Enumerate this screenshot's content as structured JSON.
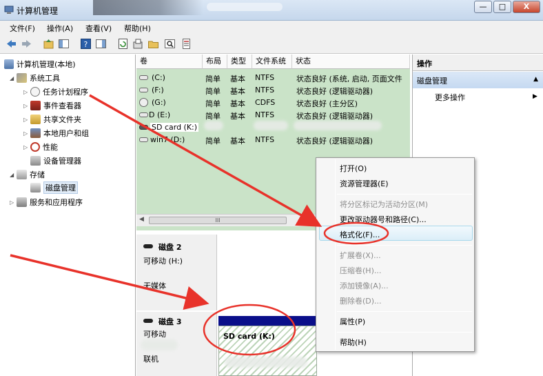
{
  "window": {
    "title": "计算机管理",
    "buttons": [
      "—",
      "□",
      "X"
    ]
  },
  "menu": [
    "文件(F)",
    "操作(A)",
    "查看(V)",
    "帮助(H)"
  ],
  "toolbar": {
    "icons": [
      "back-icon",
      "forward-icon",
      "up-icon",
      "show-hide-tree-icon",
      "help-icon",
      "show-hide-action-icon",
      "refresh-icon",
      "properties-icon",
      "open-folder-icon",
      "search-icon",
      "settings-list-icon"
    ]
  },
  "tree": {
    "root": "计算机管理(本地)",
    "system_tools": "系统工具",
    "task_scheduler": "任务计划程序",
    "event_viewer": "事件查看器",
    "shared_folders": "共享文件夹",
    "local_users": "本地用户和组",
    "performance": "性能",
    "device_manager": "设备管理器",
    "storage": "存储",
    "disk_management": "磁盘管理",
    "services": "服务和应用程序"
  },
  "volumes": {
    "headers": [
      "卷",
      "布局",
      "类型",
      "文件系统",
      "状态"
    ],
    "rows": [
      {
        "vol": "(C:)",
        "layout": "简单",
        "type": "基本",
        "fs": "NTFS",
        "status": "状态良好 (系统, 启动, 页面文件"
      },
      {
        "vol": "(F:)",
        "layout": "简单",
        "type": "基本",
        "fs": "NTFS",
        "status": "状态良好 (逻辑驱动器)"
      },
      {
        "vol": "(G:)",
        "layout": "简单",
        "type": "基本",
        "fs": "CDFS",
        "status": "状态良好 (主分区)"
      },
      {
        "vol": "D (E:)",
        "layout": "简单",
        "type": "基本",
        "fs": "NTFS",
        "status": "状态良好 (逻辑驱动器)"
      },
      {
        "vol": "SD card (K:)",
        "layout": "",
        "type": "",
        "fs": "",
        "status": ""
      },
      {
        "vol": "win7 (D:)",
        "layout": "简单",
        "type": "基本",
        "fs": "NTFS",
        "status": "状态良好 (逻辑驱动器)"
      }
    ],
    "scroll_label": "III"
  },
  "disks": {
    "disk2": {
      "name": "磁盘 2",
      "kind": "可移动 (H:)",
      "media": "无媒体"
    },
    "disk3": {
      "name": "磁盘 3",
      "kind": "可移动",
      "status": "联机",
      "partition": "SD card  (K:)"
    }
  },
  "actions": {
    "header": "操作",
    "section": "磁盘管理",
    "more": "更多操作"
  },
  "context_menu": {
    "open": "打开(O)",
    "explorer": "资源管理器(E)",
    "mark_active": "将分区标记为活动分区(M)",
    "change_letter": "更改驱动器号和路径(C)...",
    "format": "格式化(F)...",
    "extend": "扩展卷(X)...",
    "shrink": "压缩卷(H)...",
    "add_mirror": "添加镜像(A)...",
    "delete": "删除卷(D)...",
    "properties": "属性(P)",
    "help": "帮助(H)"
  },
  "colors": {
    "volume_bg": "#cae3c8",
    "partition_bar": "#0a0f8a",
    "annotation_red": "#e8322a"
  }
}
